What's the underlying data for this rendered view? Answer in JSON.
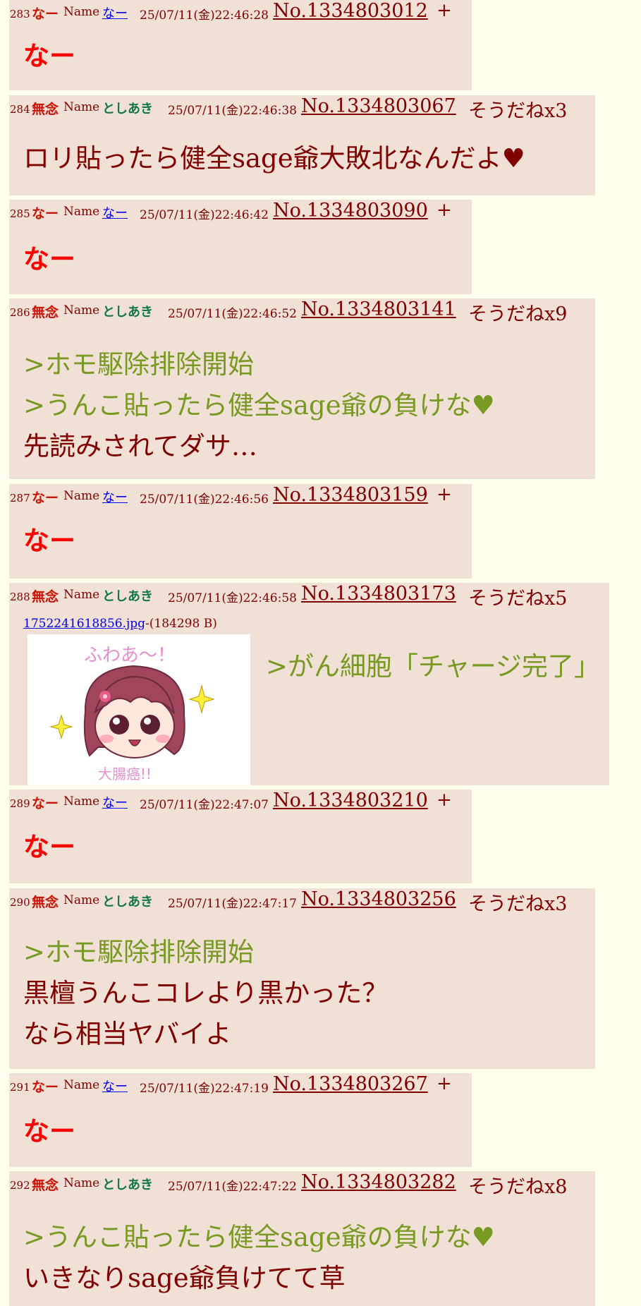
{
  "labels": {
    "name": "Name",
    "plus": "+"
  },
  "colors": {
    "reply_bg": "#f0e0d6",
    "page_bg": "#ffffee",
    "quote": "#789922",
    "subject": "#cc1105",
    "name": "#117743"
  },
  "posts": [
    {
      "num": "283",
      "subject": "なー",
      "name": "なー",
      "date": "25/07/11(金)22:46:28",
      "no": "No.1334803012",
      "sodane": "+",
      "lines": [
        "なー"
      ]
    },
    {
      "num": "284",
      "subject": "無念",
      "name": "としあき",
      "date": "25/07/11(金)22:46:38",
      "no": "No.1334803067",
      "sodane": "そうだねx3",
      "lines": [
        "ロリ貼ったら健全sage爺大敗北なんだよ♥"
      ]
    },
    {
      "num": "285",
      "subject": "なー",
      "name": "なー",
      "date": "25/07/11(金)22:46:42",
      "no": "No.1334803090",
      "sodane": "+",
      "lines": [
        "なー"
      ]
    },
    {
      "num": "286",
      "subject": "無念",
      "name": "としあき",
      "date": "25/07/11(金)22:46:52",
      "no": "No.1334803141",
      "sodane": "そうだねx9",
      "lines": [
        ">ホモ駆除排除開始",
        ">うんこ貼ったら健全sage爺の負けな♥",
        "先読みされてダサ…"
      ]
    },
    {
      "num": "287",
      "subject": "なー",
      "name": "なー",
      "date": "25/07/11(金)22:46:56",
      "no": "No.1334803159",
      "sodane": "+",
      "lines": [
        "なー"
      ]
    },
    {
      "num": "288",
      "subject": "無念",
      "name": "としあき",
      "date": "25/07/11(金)22:46:58",
      "no": "No.1334803173",
      "sodane": "そうだねx5",
      "file": "1752241618856.jpg",
      "filesize": "-(184298 B)",
      "image_text_top": "ふわあ～！",
      "image_text_bottom": "大腸癌!!",
      "lines": [
        ">がん細胞「チャージ完了」"
      ]
    },
    {
      "num": "289",
      "subject": "なー",
      "name": "なー",
      "date": "25/07/11(金)22:47:07",
      "no": "No.1334803210",
      "sodane": "+",
      "lines": [
        "なー"
      ]
    },
    {
      "num": "290",
      "subject": "無念",
      "name": "としあき",
      "date": "25/07/11(金)22:47:17",
      "no": "No.1334803256",
      "sodane": "そうだねx3",
      "lines": [
        ">ホモ駆除排除開始",
        "黒檀うんこコレより黒かった？",
        "なら相当ヤバイよ"
      ]
    },
    {
      "num": "291",
      "subject": "なー",
      "name": "なー",
      "date": "25/07/11(金)22:47:19",
      "no": "No.1334803267",
      "sodane": "+",
      "lines": [
        "なー"
      ]
    },
    {
      "num": "292",
      "subject": "無念",
      "name": "としあき",
      "date": "25/07/11(金)22:47:22",
      "no": "No.1334803282",
      "sodane": "そうだねx8",
      "lines": [
        ">うんこ貼ったら健全sage爺の負けな♥",
        "いきなりsage爺負けてて草"
      ]
    }
  ]
}
